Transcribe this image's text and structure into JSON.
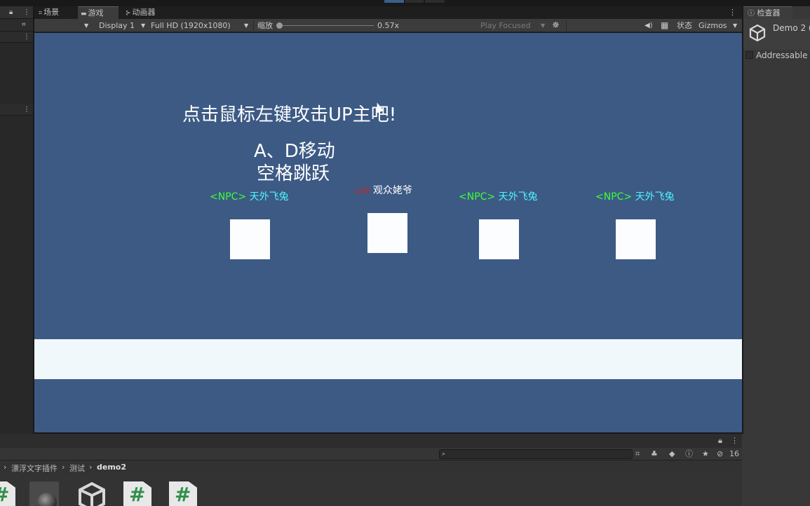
{
  "tabs": [
    {
      "label": "场景",
      "icon": "grid-icon"
    },
    {
      "label": "游戏",
      "icon": "gamepad-icon",
      "active": true
    },
    {
      "label": "动画器",
      "icon": "animator-icon"
    }
  ],
  "toolbar": {
    "display": "Display 1",
    "resolution": "Full HD (1920x1080)",
    "scale_label": "缩放",
    "scale_value": "0.57x",
    "play_mode": "Play Focused",
    "stats": "状态",
    "gizmos": "Gizmos"
  },
  "game": {
    "title": "点击鼠标左键攻击UP主吧!",
    "instructions_line1": "A、D移动",
    "instructions_line2": "空格跳跃",
    "npcs": [
      {
        "tag": "<NPC>",
        "name": "天外飞兔"
      },
      {
        "tag": "Lv6",
        "name": "观众姥爷"
      },
      {
        "tag": "<NPC>",
        "name": "天外飞兔"
      },
      {
        "tag": "<NPC>",
        "name": "天外飞兔"
      }
    ]
  },
  "inspector": {
    "tab": "检查器",
    "object_name": "Demo 2 (",
    "addressable_label": "Addressable"
  },
  "project": {
    "breadcrumb": [
      "漂浮文字插件",
      "测试",
      "demo2"
    ],
    "hidden_count": "16"
  },
  "colors": {
    "game_background": "#3c5a84",
    "npc_tag": "#3cff3c",
    "npc_name": "#4ff5ff",
    "level_tag": "#d62020"
  }
}
